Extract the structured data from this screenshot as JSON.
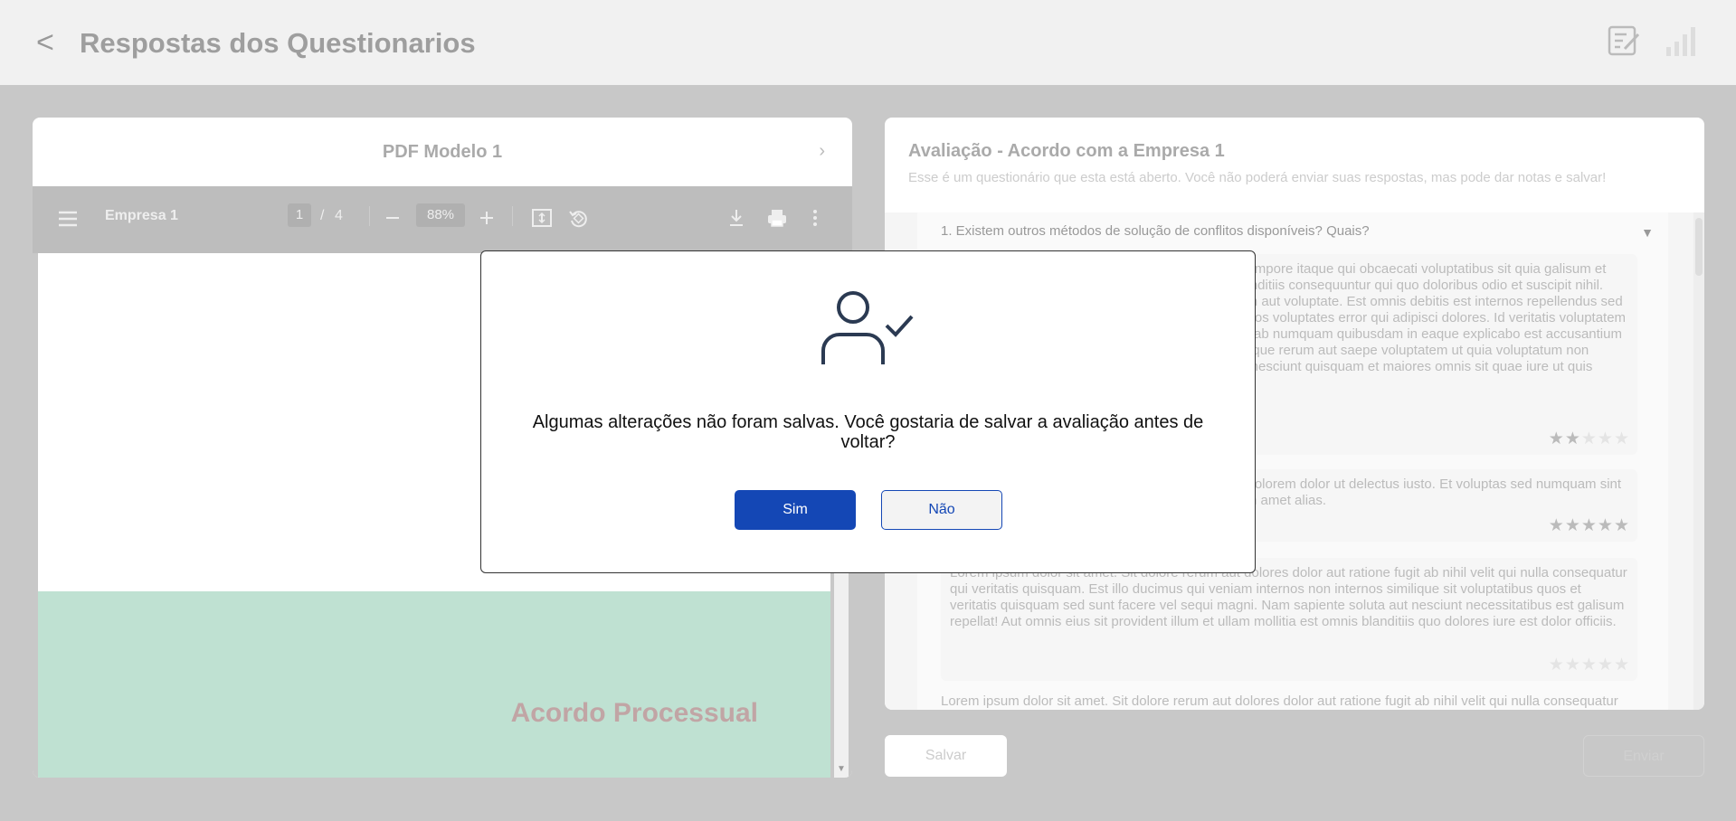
{
  "header": {
    "back_glyph": "<",
    "title": "Respostas dos Questionarios",
    "icons": [
      "edit-note-icon",
      "bar-chart-icon"
    ]
  },
  "pdf_panel": {
    "title": "PDF Modelo 1",
    "next_glyph": "›",
    "toolbar": {
      "document_name": "Empresa 1",
      "current_page": "1",
      "page_sep": "/",
      "total_pages": "4",
      "zoom": "88%"
    },
    "page_heading": "Acordo Processual"
  },
  "evaluation_panel": {
    "title": "Avaliação - Acordo com a Empresa 1",
    "subtitle": "Esse é um questionário que esta está aberto. Você não poderá enviar suas respostas, mas pode dar notas e salvar!",
    "question": "1. Existem outros métodos de solução de conflitos disponíveis? Quais?",
    "answers": [
      {
        "text": "Lorem ipsum dolor sit amet. Et impedit rerum 33 tempore itaque qui obcaecati voluptatibus sit quia galisum et vero. At omnis alias in dolores perspiciatis quo blanditiis consequuntur qui quo doloribus odio et suscipit nihil. Eum voluptas rerum et perspiciatis aut fugiat ipsam aut voluptate. Est omnis debitis est internos repellendus sed maiores debitis et dolor optio non harum aliquam eos voluptates error qui adipisci dolores. Id veritatis voluptatem in reprehenderit non fuga numquam. Eos odit nihil ab numquam quibusdam in eaque explicabo est accusantium quia eos eius galisum qui possimus fugiat. Quo neque rerum aut saepe voluptatem ut quia voluptatum non molestias ut tempore vel ut recusandae quas. Est nesciunt quisquam et maiores omnis sit quae iure ut quis placeat facilis.",
        "rating": 2
      },
      {
        "text": "Lorem ipsum dolor sit amet aut reprehenderit aut dolorem dolor ut delectus iusto. Et voluptas sed numquam sint qui quasi ullam repellat quo consequatur enim nam amet alias.",
        "rating": 5
      },
      {
        "text": "Lorem ipsum dolor sit amet. Sit dolore rerum aut dolores dolor aut ratione fugit ab nihil velit qui nulla consequatur qui veritatis quisquam. Est illo ducimus qui veniam internos non internos similique sit voluptatibus quos et veritatis quisquam sed sunt facere vel sequi magni. Nam sapiente soluta aut nesciunt necessitatibus est galisum repellat! Aut omnis eius sit provident illum et ullam mollitia est omnis blanditiis quo dolores iure est dolor officiis.",
        "rating": 0
      }
    ],
    "partial_answer": "Lorem ipsum dolor sit amet. Sit dolore rerum aut dolores dolor aut ratione fugit ab nihil velit qui nulla consequatur"
  },
  "footer": {
    "save_label": "Salvar",
    "send_label": "Enviar"
  },
  "modal": {
    "icon": "user-check-icon",
    "message": "Algumas alterações não foram salvas. Você gostaria de salvar a avaliação antes de voltar?",
    "yes_label": "Sim",
    "no_label": "Não"
  },
  "colors": {
    "primary": "#1447b5",
    "overlay": "#c8c8c8",
    "pdf_green": "#bfe1d2"
  }
}
